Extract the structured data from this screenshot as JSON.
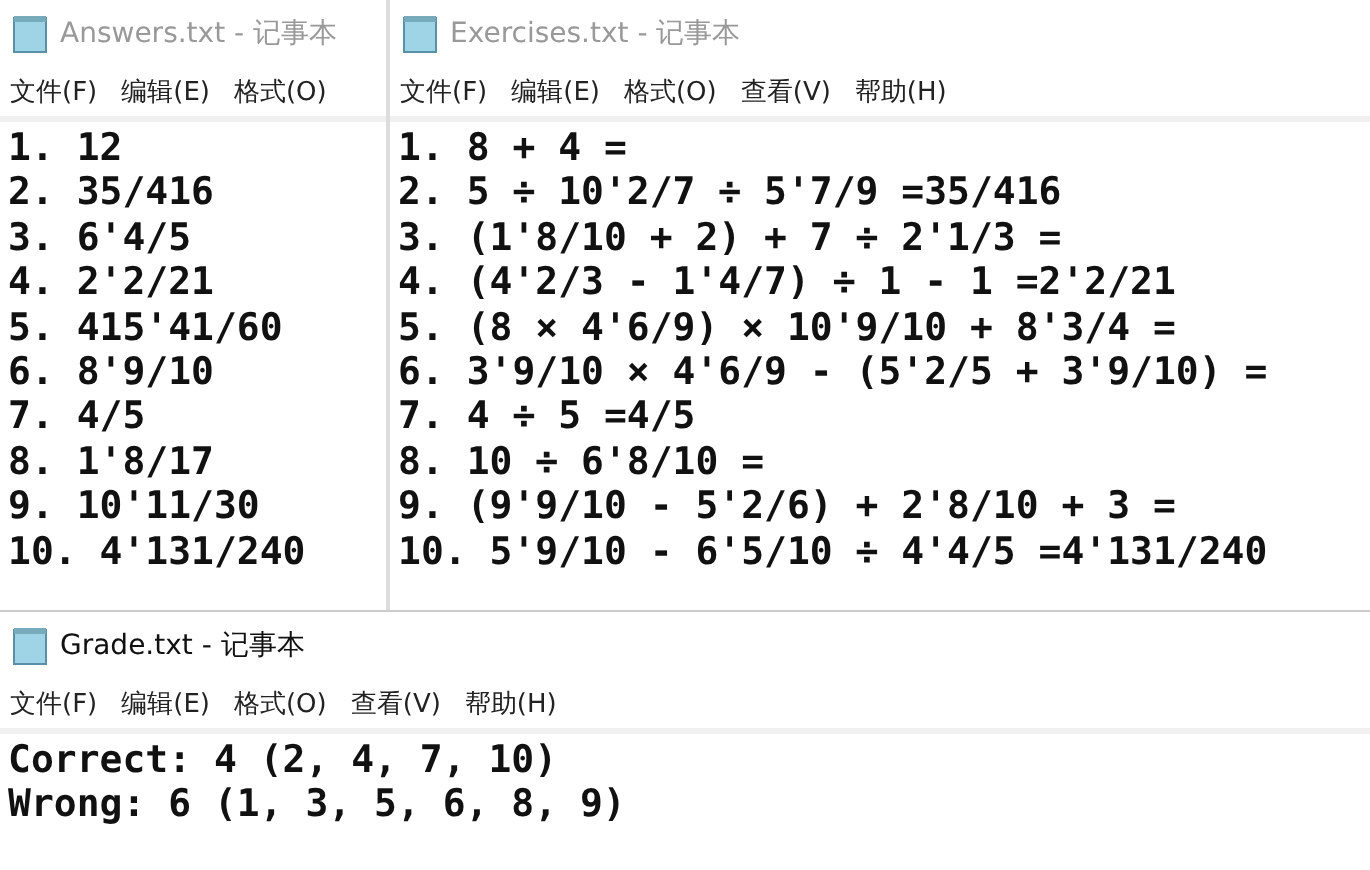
{
  "windows": [
    {
      "title": "Answers.txt - 记事本",
      "active": false,
      "menu": [
        "文件(F)",
        "编辑(E)",
        "格式(O)"
      ],
      "lines": [
        "1. 12",
        "2. 35/416",
        "3. 6'4/5",
        "4. 2'2/21",
        "5. 415'41/60",
        "6. 8'9/10",
        "7. 4/5",
        "8. 1'8/17",
        "9. 10'11/30",
        "10. 4'131/240"
      ]
    },
    {
      "title": "Exercises.txt - 记事本",
      "active": false,
      "menu": [
        "文件(F)",
        "编辑(E)",
        "格式(O)",
        "查看(V)",
        "帮助(H)"
      ],
      "lines": [
        "1. 8 + 4 =",
        "2. 5 ÷ 10'2/7 ÷ 5'7/9 =35/416",
        "3. (1'8/10 + 2) + 7 ÷ 2'1/3 =",
        "4. (4'2/3 - 1'4/7) ÷ 1 - 1 =2'2/21",
        "5. (8 × 4'6/9) × 10'9/10 + 8'3/4 =",
        "6. 3'9/10 × 4'6/9 - (5'2/5 + 3'9/10) =",
        "7. 4 ÷ 5 =4/5",
        "8. 10 ÷ 6'8/10 =",
        "9. (9'9/10 - 5'2/6) + 2'8/10 + 3 =",
        "10. 5'9/10 - 6'5/10 ÷ 4'4/5 =4'131/240"
      ]
    },
    {
      "title": "Grade.txt - 记事本",
      "active": true,
      "menu": [
        "文件(F)",
        "编辑(E)",
        "格式(O)",
        "查看(V)",
        "帮助(H)"
      ],
      "lines": [
        "Correct: 4 (2, 4, 7, 10)",
        "Wrong: 6 (1, 3, 5, 6, 8, 9)"
      ]
    }
  ]
}
